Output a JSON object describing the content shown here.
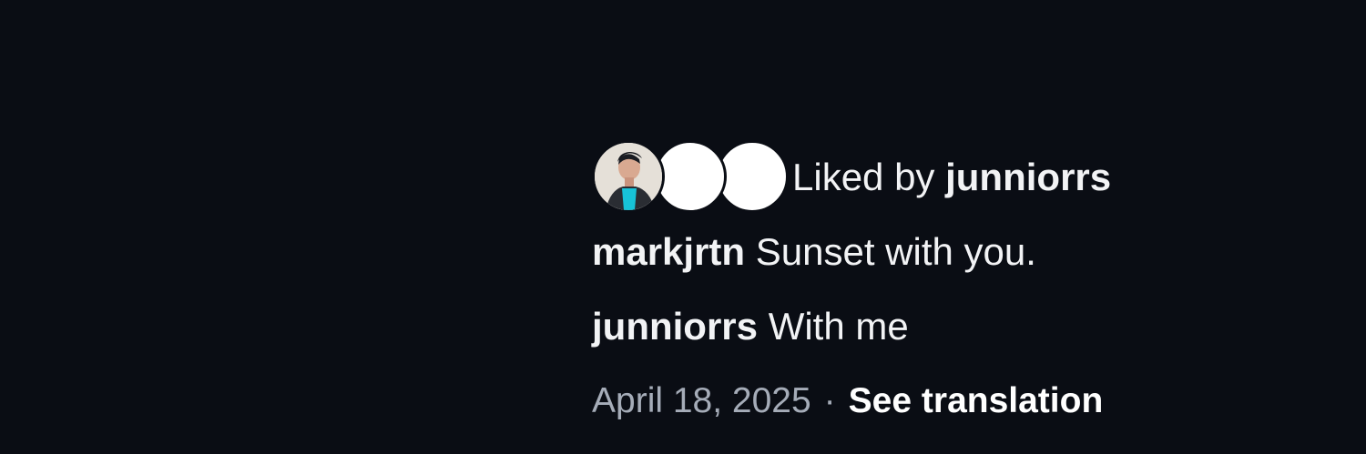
{
  "likes": {
    "prefix": "Liked by",
    "user": "junniorrs"
  },
  "caption": {
    "username": "markjrtn",
    "text": "Sunset with you."
  },
  "comment": {
    "username": "junniorrs",
    "text": "With me"
  },
  "meta": {
    "date": "April 18, 2025",
    "separator": "·",
    "translation_link": "See translation"
  },
  "colors": {
    "background": "#0a0d14",
    "primary_text": "#f2f3f5",
    "secondary_text": "#a5acb8"
  }
}
